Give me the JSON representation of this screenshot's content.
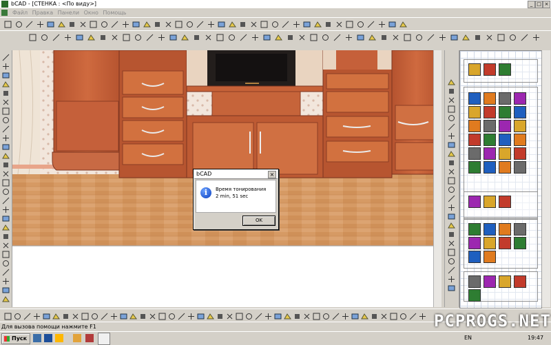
{
  "window": {
    "title": "bCAD - [СТЕНКА : <По виду>]"
  },
  "menu": {
    "items": [
      "Файл",
      "Правка",
      "Панели",
      "Окно",
      "Помощь"
    ]
  },
  "dialog": {
    "title": "bCAD",
    "message_line1": "Время тонирования",
    "message_line2": "2 min, 51 sec",
    "ok_label": "OK",
    "close_glyph": "×"
  },
  "status": {
    "text": "Для вызова помощи нажмите F1"
  },
  "taskbar": {
    "start_label": "Пуск",
    "lang": "EN",
    "clock": "19:47"
  },
  "watermark": "PCPROGS.NET",
  "icons": {
    "top_toolbar_row1": 38,
    "top_toolbar_row2": 44,
    "left_toolbar": 28,
    "right_palette": 42,
    "bottom_toolbar": 44
  },
  "colors": {
    "furniture": "#c8623a",
    "floor": "#d59a66",
    "wall": "#f2e6dc",
    "dialog_info": "#1a56d6",
    "panel_grid": "#cfd8e6"
  }
}
